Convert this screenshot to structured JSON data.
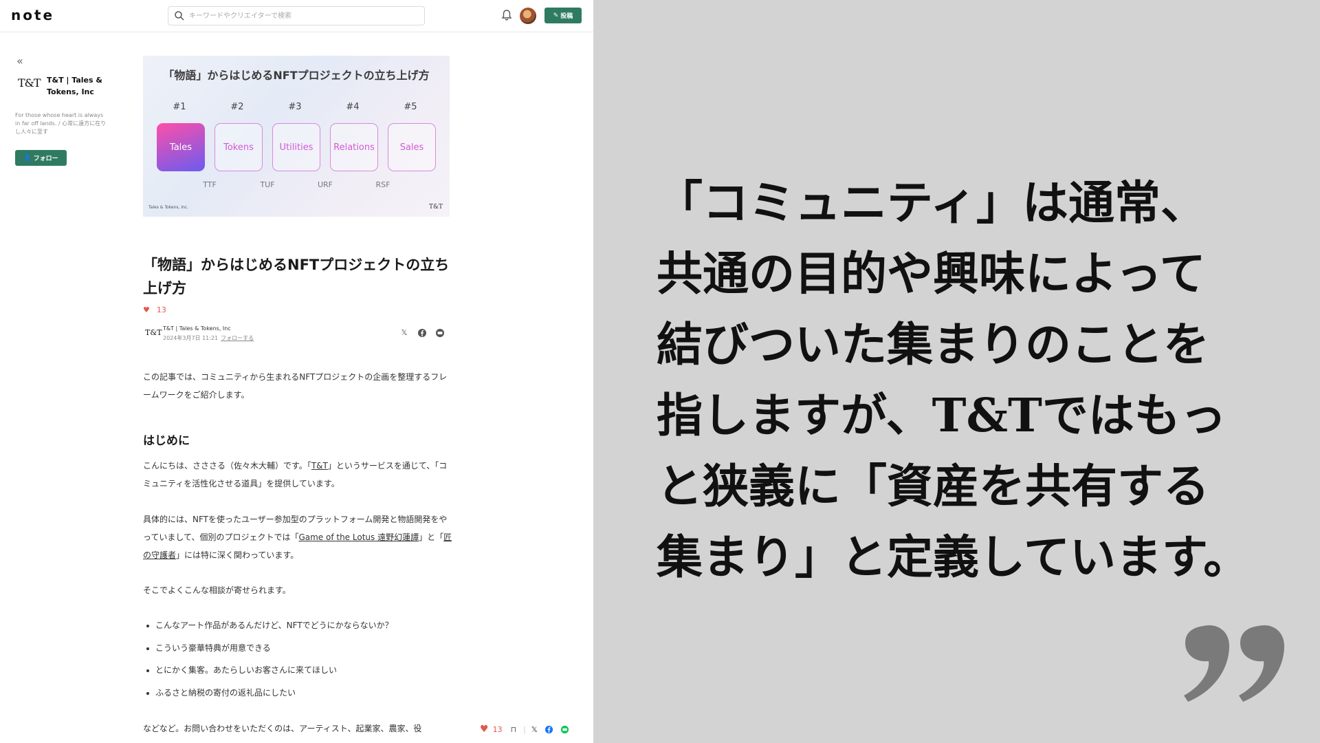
{
  "header": {
    "logo": "note",
    "search_placeholder": "キーワードやクリエイターで検索",
    "post_label": "投稿"
  },
  "profile": {
    "logo": "T&T",
    "name": "T&T | Tales & Tokens, Inc",
    "description": "For those whose heart is always in far off lands. / 心常に遠方に在りし人々に至す",
    "follow_label": "フォロー"
  },
  "hero": {
    "title": "「物語」からはじめるNFTプロジェクトの立ち上げ方",
    "steps": [
      {
        "num": "#1",
        "label": "Tales"
      },
      {
        "num": "#2",
        "label": "Tokens"
      },
      {
        "num": "#3",
        "label": "Utilities"
      },
      {
        "num": "#4",
        "label": "Relations"
      },
      {
        "num": "#5",
        "label": "Sales"
      }
    ],
    "codes": [
      "TTF",
      "TUF",
      "URF",
      "RSF"
    ],
    "footer_left": "Tales & Tokens, Inc.",
    "footer_right": "T&T"
  },
  "article": {
    "title": "「物語」からはじめるNFTプロジェクトの立ち上げ方",
    "likes": "13",
    "author_logo": "T&T",
    "author_name": "T&T | Tales & Tokens, Inc",
    "date": "2024年3月7日 11:21",
    "follow_link": "フォローする",
    "intro": "この記事では、コミュニティから生まれるNFTプロジェクトの企画を整理するフレームワークをご紹介します。",
    "heading": "はじめに",
    "p1_a": "こんにちは、さささる（佐々木大輔）です。「",
    "p1_link": "T&T",
    "p1_b": "」というサービスを通じて、「コミュニティを活性化させる道具」を提供しています。",
    "p2_a": "具体的には、NFTを使ったユーザー参加型のプラットフォーム開発と物語開発をやっていまして、個別のプロジェクトでは「",
    "p2_link1": "Game of the Lotus 遠野幻蓮譚",
    "p2_b": "」と「",
    "p2_link2": "匠の守護者",
    "p2_c": "」には特に深く関わっています。",
    "p3": "そこでよくこんな相談が寄せられます。",
    "bullets": [
      "こんなアート作品があるんだけど、NFTでどうにかならないか？",
      "こういう豪華特典が用意できる",
      "とにかく集客。あたらしいお客さんに来てほしい",
      "ふるさと納税の寄付の返礼品にしたい"
    ],
    "p4": "などなど。お問い合わせをいただくのは、アーティスト、起業家、農家、役"
  },
  "action_bar": {
    "likes": "13"
  },
  "quote": {
    "lines": [
      "「コミュニティ」は通常、",
      "共通の目的や興味によって",
      "結びついた集まりのことを",
      "指しますが、T&Tではもっ",
      "と狭義に「資産を共有する",
      "集まり」と定義しています。"
    ]
  },
  "colors": {
    "brand_green": "#2f7b62",
    "like_red": "#e2574c",
    "quote_bg": "#d3d3d3"
  }
}
